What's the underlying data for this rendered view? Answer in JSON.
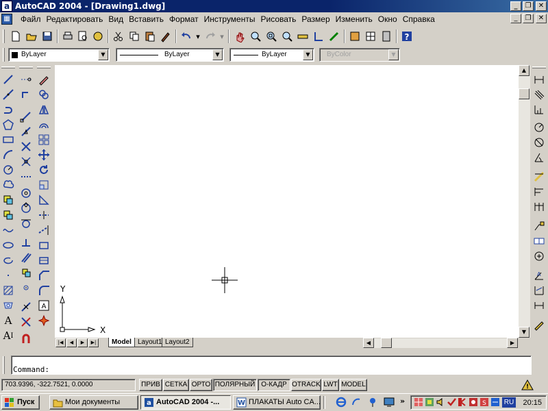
{
  "window": {
    "title": "AutoCAD 2004 - [Drawing1.dwg]",
    "minimize": "_",
    "restore": "❐",
    "close": "✕"
  },
  "menubar": {
    "items": [
      "Файл",
      "Редактировать",
      "Вид",
      "Вставить",
      "Формат",
      "Инструменты",
      "Рисовать",
      "Размер",
      "Изменить",
      "Окно",
      "Справка"
    ]
  },
  "properties": {
    "color": "ByLayer",
    "linetype": "ByLayer",
    "lineweight": "ByLayer",
    "plotstyle": "ByColor"
  },
  "ucs": {
    "x_label": "X",
    "y_label": "Y"
  },
  "layout_tabs": [
    "Model",
    "Layout1",
    "Layout2"
  ],
  "command": {
    "prompt": "Command:"
  },
  "status": {
    "coordinates": "703.9396, -322.7521, 0.0000",
    "toggles": [
      "ПРИВ",
      "СЕТКА",
      "ОРТО",
      "ПОЛЯРНЫЙ",
      "О-КАДР",
      "OTRACK",
      "LWT",
      "MODEL"
    ]
  },
  "taskbar": {
    "start": "Пуск",
    "tasks": [
      "Мои документы",
      "AutoCAD 2004 -...",
      "ПЛАКАТЫ Auto CA..."
    ],
    "clock": "20:15",
    "lang": "RU"
  },
  "colors": {
    "title_bar": "#0a246a",
    "face": "#d4d0c8",
    "canvas": "#ffffff"
  }
}
